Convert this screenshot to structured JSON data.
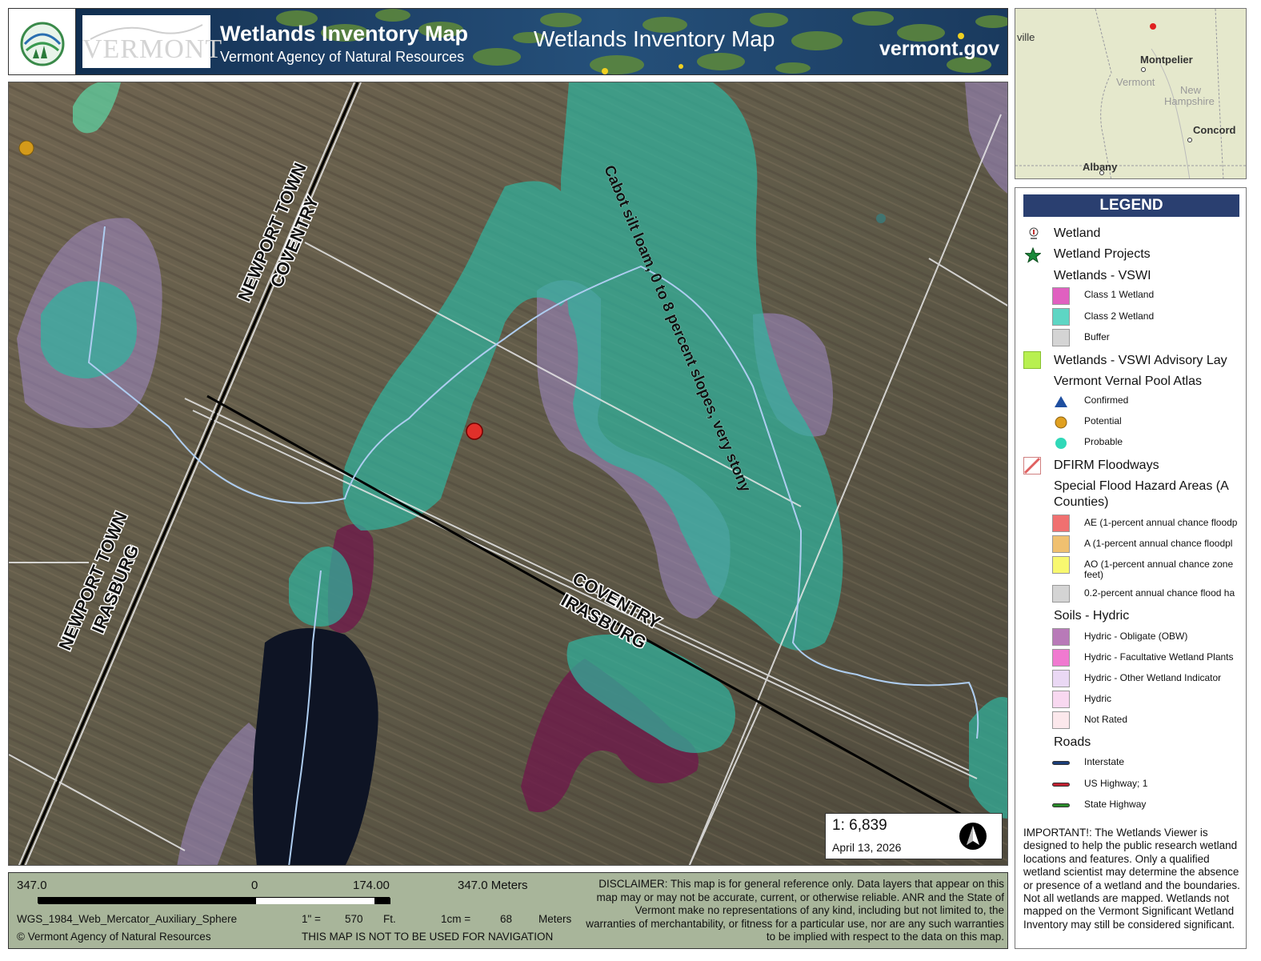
{
  "header": {
    "title": "Wetlands Inventory Map",
    "subtitle": "Vermont Agency of Natural Resources",
    "center_title": "Wetlands Inventory Map",
    "site": "vermont.gov",
    "state_wordmark": "VERMONT"
  },
  "map": {
    "town_labels": [
      {
        "line1": "NEWPORT TOWN",
        "line2": "COVENTRY"
      },
      {
        "line1": "NEWPORT TOWN",
        "line2": "IRASBURG"
      },
      {
        "line1": "COVENTRY",
        "line2": "IRASBURG"
      }
    ],
    "soil_label": "Cabot silt loam, 0 to 8 percent slopes, very stony",
    "colors": {
      "class2_wetland": "#2fb5a0",
      "buffer_purple": "#9b86c4",
      "hydric_dark": "#6e1a4a",
      "marker_red": "#e0302a",
      "marker_orange": "#d49a1a",
      "advisory_green": "#4fc060"
    }
  },
  "scale": {
    "ratio": "1:  6,839",
    "date": "April 13, 2026",
    "north_icon": "north-arrow-icon"
  },
  "overview": {
    "labels": [
      "ville",
      "Montpelier",
      "Vermont",
      "New",
      "Hampshire",
      "Concord",
      "Albany"
    ]
  },
  "legend": {
    "title": "LEGEND",
    "headings": {
      "wetland": "Wetland",
      "wetland_projects": "Wetland Projects",
      "vswi": "Wetlands - VSWI",
      "vswi_advisory": "Wetlands - VSWI Advisory Lay",
      "vernal": "Vermont Vernal Pool Atlas",
      "dfirm": "DFIRM Floodways",
      "sfha1": "Special Flood Hazard Areas (A",
      "sfha2": "Counties)",
      "soils": "Soils - Hydric",
      "roads": "Roads"
    },
    "vswi_items": [
      {
        "label": "Class 1 Wetland",
        "color": "#e060c0"
      },
      {
        "label": "Class 2 Wetland",
        "color": "#5ed6c4"
      },
      {
        "label": "Buffer",
        "color": "#d4d4d4"
      }
    ],
    "vernal_items": [
      {
        "label": "Confirmed",
        "color": "#1f4fa0"
      },
      {
        "label": "Potential",
        "color": "#e0a020"
      },
      {
        "label": "Probable",
        "color": "#30d8b8"
      }
    ],
    "flood_items": [
      {
        "label": "AE (1-percent annual chance floodp",
        "color": "#f07070"
      },
      {
        "label": "A (1-percent annual chance floodpl",
        "color": "#f0c070"
      },
      {
        "label": "AO (1-percent annual chance zone",
        "label2": "feet)",
        "color": "#f8f870"
      },
      {
        "label": "0.2-percent annual chance flood ha",
        "color": "#d4d4d4"
      }
    ],
    "soil_items": [
      {
        "label": "Hydric - Obligate (OBW)",
        "color": "#b87ab8"
      },
      {
        "label": "Hydric - Facultative Wetland Plants",
        "color": "#f07ad0"
      },
      {
        "label": "Hydric - Other Wetland Indicator",
        "color": "#ead8f4"
      },
      {
        "label": "Hydric",
        "color": "#f8d8f0"
      },
      {
        "label": "Not Rated",
        "color": "#fce8ec"
      }
    ],
    "road_items": [
      {
        "label": "Interstate",
        "color": "#1c3f7a"
      },
      {
        "label": "US Highway; 1",
        "color": "#c02030"
      },
      {
        "label": "State Highway",
        "color": "#2a8a2a"
      }
    ],
    "important": "IMPORTANT!: The Wetlands Viewer is designed to help the public research wetland locations and features. Only a qualified wetland scientist may determine the absence or presence of a wetland and the boundaries. Not all wetlands are mapped. Wetlands not mapped on the Vermont Significant Wetland Inventory may still be considered significant."
  },
  "footer": {
    "scale_left": "347.0",
    "scale_zero": "0",
    "scale_mid": "174.00",
    "scale_right": "347.0 Meters",
    "projection": "WGS_1984_Web_Mercator_Auxiliary_Sphere",
    "inch_label": "1\" =",
    "inch_value": "570",
    "inch_unit": "Ft.",
    "cm_label": "1cm =",
    "cm_value": "68",
    "cm_unit": "Meters",
    "copyright": "© Vermont Agency of Natural Resources",
    "navigation": "THIS MAP IS NOT TO BE USED FOR NAVIGATION",
    "disclaimer": "DISCLAIMER: This map is for general reference only. Data layers that appear on this map may or may not be accurate, current, or otherwise reliable. ANR and the State of Vermont make no representations of any kind, including but not limited to, the warranties of merchantability, or fitness for a particular use, nor are any such warranties to be implied with respect to the data on this map."
  }
}
